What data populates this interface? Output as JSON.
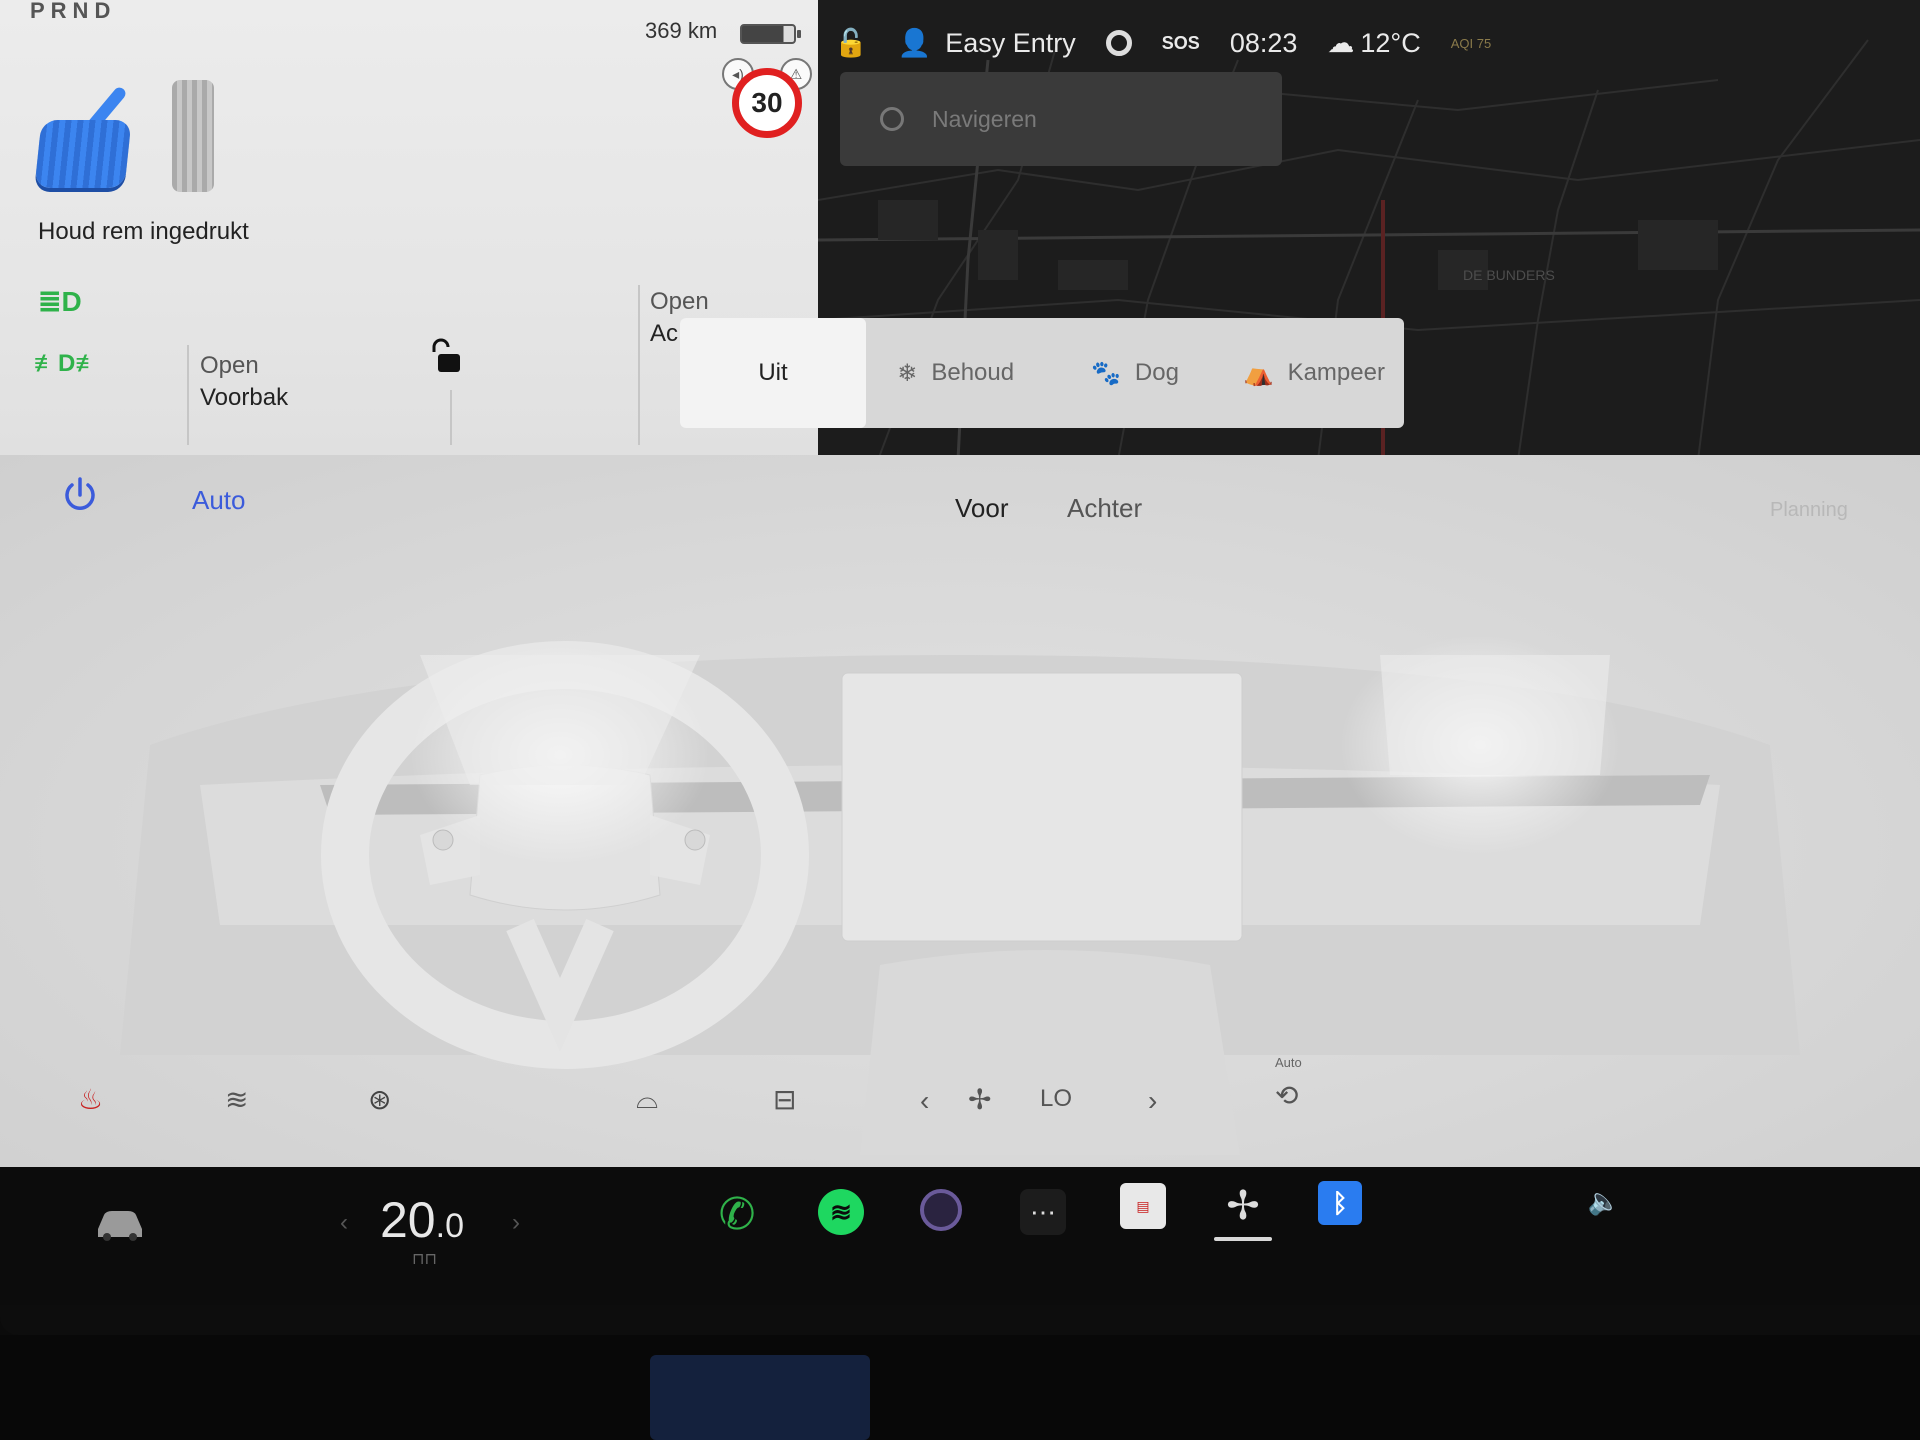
{
  "drive": {
    "gear": "PRND",
    "range": "369 km",
    "speed_limit": "30",
    "hold_brake_text": "Houd rem ingedrukt",
    "frunk_label_top": "Open",
    "frunk_label_bottom": "Voorbak",
    "trunk_label_top": "Open",
    "trunk_label_bottom": "Ac"
  },
  "topbar": {
    "profile": "Easy Entry",
    "sos": "SOS",
    "time": "08:23",
    "temperature": "12°C",
    "aqi": "AQI 75"
  },
  "navigation": {
    "placeholder": "Navigeren",
    "map_label": "DE BUNDERS"
  },
  "camp_mode": {
    "options": [
      "Uit",
      "Behoud",
      "Dog",
      "Kampeer"
    ],
    "selected": "Uit"
  },
  "climate": {
    "mode": "Auto",
    "tabs": [
      "Voor",
      "Achter"
    ],
    "active_tab": "Voor",
    "planning": "Planning",
    "fan_speed": "LO",
    "recirculation_label": "Auto"
  },
  "dock": {
    "temperature_whole": "20",
    "temperature_decimal": ".0"
  },
  "colors": {
    "accent_blue": "#3b5bdb",
    "green": "#2fb24a",
    "speed_red": "#e02020",
    "brake_blue": "#3c85f0"
  }
}
